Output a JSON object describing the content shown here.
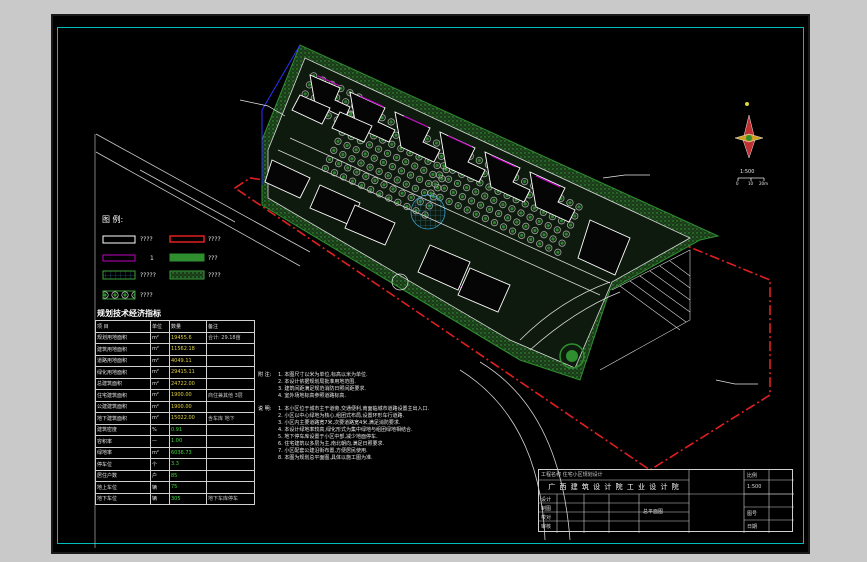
{
  "legend": {
    "title": "图 例:",
    "items": [
      {
        "label": "????"
      },
      {
        "label": "????"
      },
      {
        "label": "1"
      },
      {
        "label": "???"
      },
      {
        "label": "?????"
      },
      {
        "label": "????"
      },
      {
        "label": "????"
      }
    ]
  },
  "tech_table": {
    "title": "规划技术经济指标",
    "header": [
      "项  目",
      "单位",
      "数量",
      "备注"
    ],
    "rows": [
      {
        "c1": "规划用地面积",
        "c2": "m²",
        "c3": "19455.6",
        "c4": "合计: 29.18亩"
      },
      {
        "c1": "建筑用地面积",
        "c2": "m²",
        "c3": "11562.18",
        "c4": ""
      },
      {
        "c1": "道路用地面积",
        "c2": "m²",
        "c3": "4049.11",
        "c4": ""
      },
      {
        "c1": "绿化用地面积",
        "c2": "m²",
        "c3": "29415.11",
        "c4": ""
      },
      {
        "c1": "总建筑面积",
        "c2": "m²",
        "c3": "24722.00",
        "c4": ""
      },
      {
        "c1": "住宅建筑面积",
        "c2": "m²",
        "c3": "1900.00",
        "c4": "商住兼其他 3层"
      },
      {
        "c1": "公建建筑面积",
        "c2": "m²",
        "c3": "1900.00",
        "c4": ""
      },
      {
        "c1": "地下建筑面积",
        "c2": "m²",
        "c3": "15022.00",
        "c4": "含车库 地下"
      },
      {
        "c1": "建筑密度",
        "c2": "%",
        "c3": "0.91",
        "c4": ""
      },
      {
        "c1": "容积率",
        "c2": "—",
        "c3": "1.00",
        "c4": ""
      },
      {
        "c1": "绿地率",
        "c2": "m²",
        "c3": "6036.73",
        "c4": ""
      },
      {
        "c1": "停车位",
        "c2": "个",
        "c3": "3.3",
        "c4": ""
      },
      {
        "c1": "居住户数",
        "c2": "户",
        "c3": "85",
        "c4": ""
      },
      {
        "c1": "地上车位",
        "c2": "辆",
        "c3": "75",
        "c4": ""
      },
      {
        "c1": "地下车位",
        "c2": "辆",
        "c3": "305",
        "c4": "地下车库停车"
      }
    ]
  },
  "notes": {
    "label1": "附 注:",
    "items1": [
      "1. 本图尺寸以米为单位,标高以米为单位.",
      "2. 本设计依据规划局批准用地范围.",
      "3. 建筑间距满足规范消防日照间距要求.",
      "4. 室外场地标高参照道路标高."
    ],
    "label2": "说 明:",
    "items2": [
      "1. 本小区位于城市主干道旁,交通便利,南面临城市道路设置主出入口.",
      "2. 小区以中心绿地为核心,组团式布局,设置环形车行道路.",
      "3. 小区内主要道路宽7米,次要道路宽4米,满足消防要求.",
      "4. 本设计绿地率较高,绿化形式为集中绿地与组团绿地相结合.",
      "5. 地下停车库设置于小区中部,减少地面停车.",
      "6. 住宅建筑以多层为主,南北朝向,满足日照要求.",
      "7. 小区配套公建沿街布置,方便居民使用.",
      "8. 本图为规划总平面图,具体以施工图为准."
    ]
  },
  "title_block": {
    "school": "广 西 建 筑 设 计 院  工 业 设 计 院",
    "header": "工程名称 住宅小区规划设计",
    "rows": [
      "设计",
      "制图",
      "校对",
      "审核"
    ],
    "drawing_name": "总平面图",
    "scale_label": "比例",
    "scale": "1:500",
    "sheet_no": "图号",
    "date": "日期"
  },
  "north": {
    "scale": "1:500",
    "ticks": [
      "0",
      "10",
      "20m"
    ]
  },
  "colors": {
    "background": "#000000",
    "border": "#00bcbc",
    "boundary": "#e02020",
    "greenery": "#2f8f2f",
    "road": "#d8d8d8",
    "building_outline": "#ffffff",
    "accent": "#c000c0"
  }
}
